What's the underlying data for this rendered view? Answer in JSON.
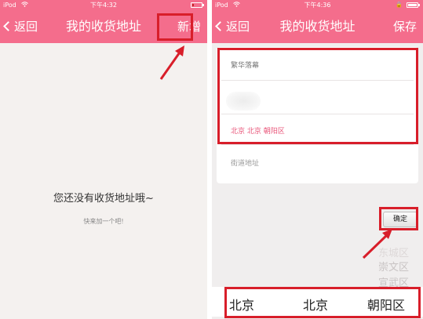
{
  "left_screen": {
    "status": {
      "carrier": "iPod",
      "time": "下午4:32"
    },
    "nav": {
      "back_label": "返回",
      "title": "我的收货地址",
      "action_label": "新增"
    },
    "empty_title": "您还没有收货地址哦~",
    "empty_subtitle": "快来加一个吧!"
  },
  "right_screen": {
    "status": {
      "carrier": "iPod",
      "time": "下午4:36"
    },
    "nav": {
      "back_label": "返回",
      "title": "我的收货地址",
      "action_label": "保存"
    },
    "form": {
      "name_value": "繁华落幕",
      "region_value": "北京 北京 朝阳区",
      "street_placeholder": "街道地址"
    },
    "confirm_label": "确定",
    "picker": {
      "faded_items": [
        "东城区",
        "崇文区",
        "宣武区"
      ],
      "selected": {
        "province": "北京",
        "city": "北京",
        "district": "朝阳区"
      }
    }
  },
  "icons": {
    "back": "chevron-left-icon",
    "wifi": "wifi-icon",
    "battery": "battery-icon",
    "lock": "lock-icon",
    "annotation": "red-arrow-icon"
  },
  "colors": {
    "nav_bg": "#f46d8c",
    "highlight": "#d81e2a",
    "region_text": "#e9567a"
  }
}
